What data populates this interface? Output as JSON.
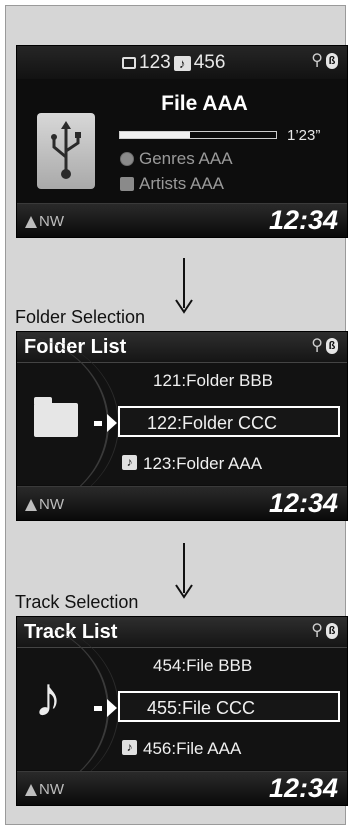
{
  "now_playing": {
    "folder_count": "123",
    "track_count": "456",
    "file_title": "File AAA",
    "elapsed": "1’23”",
    "progress_fraction": 0.45,
    "genre": "Genres AAA",
    "artist": "Artists AAA",
    "compass": "NW",
    "clock": "12:34",
    "icons": [
      "folder-icon",
      "note-icon",
      "usb-icon",
      "bluetooth-icon",
      "genre-icon",
      "artist-icon",
      "compass-arrow-icon"
    ]
  },
  "folder_selection": {
    "caption": "Folder Selection",
    "title": "Folder List",
    "items": [
      "121:Folder BBB",
      "122:Folder CCC",
      "123:Folder AAA"
    ],
    "selected_index": 1,
    "compass": "NW",
    "clock": "12:34"
  },
  "track_selection": {
    "caption": "Track Selection",
    "title": "Track List",
    "items": [
      "454:File BBB",
      "455:File CCC",
      "456:File AAA"
    ],
    "selected_index": 1,
    "compass": "NW",
    "clock": "12:34"
  },
  "colors": {
    "screen_bg": "#0d0d0d",
    "page_bg": "#d6d6d6",
    "text": "#ffffff",
    "dim_text": "#9a9a9a"
  }
}
